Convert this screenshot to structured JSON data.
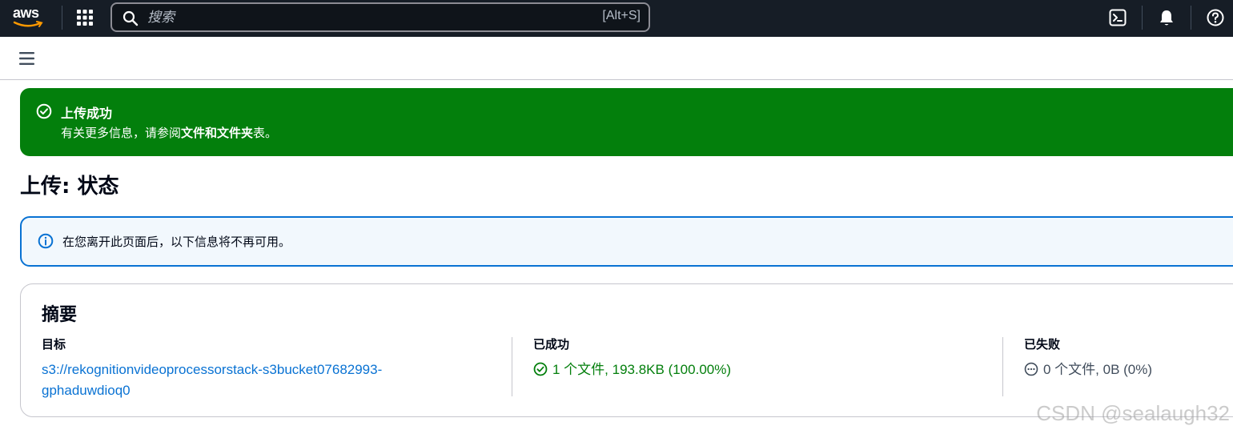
{
  "topbar": {
    "logo_text": "aws",
    "search_placeholder": "搜索",
    "search_shortcut": "[Alt+S]",
    "icons": [
      "services-grid-icon",
      "search-icon",
      "cloudshell-icon",
      "bell-icon",
      "help-icon"
    ]
  },
  "flash": {
    "title": "上传成功",
    "message_prefix": "有关更多信息，请参阅",
    "message_link": "文件和文件夹",
    "message_suffix": "表。",
    "color": "#037f0c"
  },
  "page": {
    "title": "上传: 状态"
  },
  "info_alert": {
    "text": "在您离开此页面后，以下信息将不再可用。",
    "color": "#0972d3"
  },
  "summary": {
    "heading": "摘要",
    "destination": {
      "label": "目标",
      "value_line1": "s3://rekognitionvideoprocessorstack-s3bucket07682993-",
      "value_line2": "gphaduwdioq0"
    },
    "succeeded": {
      "label": "已成功",
      "value": "1 个文件, 193.8KB (100.00%)"
    },
    "failed": {
      "label": "已失败",
      "value": "0 个文件, 0B (0%)"
    }
  },
  "watermark": "CSDN @sealaugh32"
}
